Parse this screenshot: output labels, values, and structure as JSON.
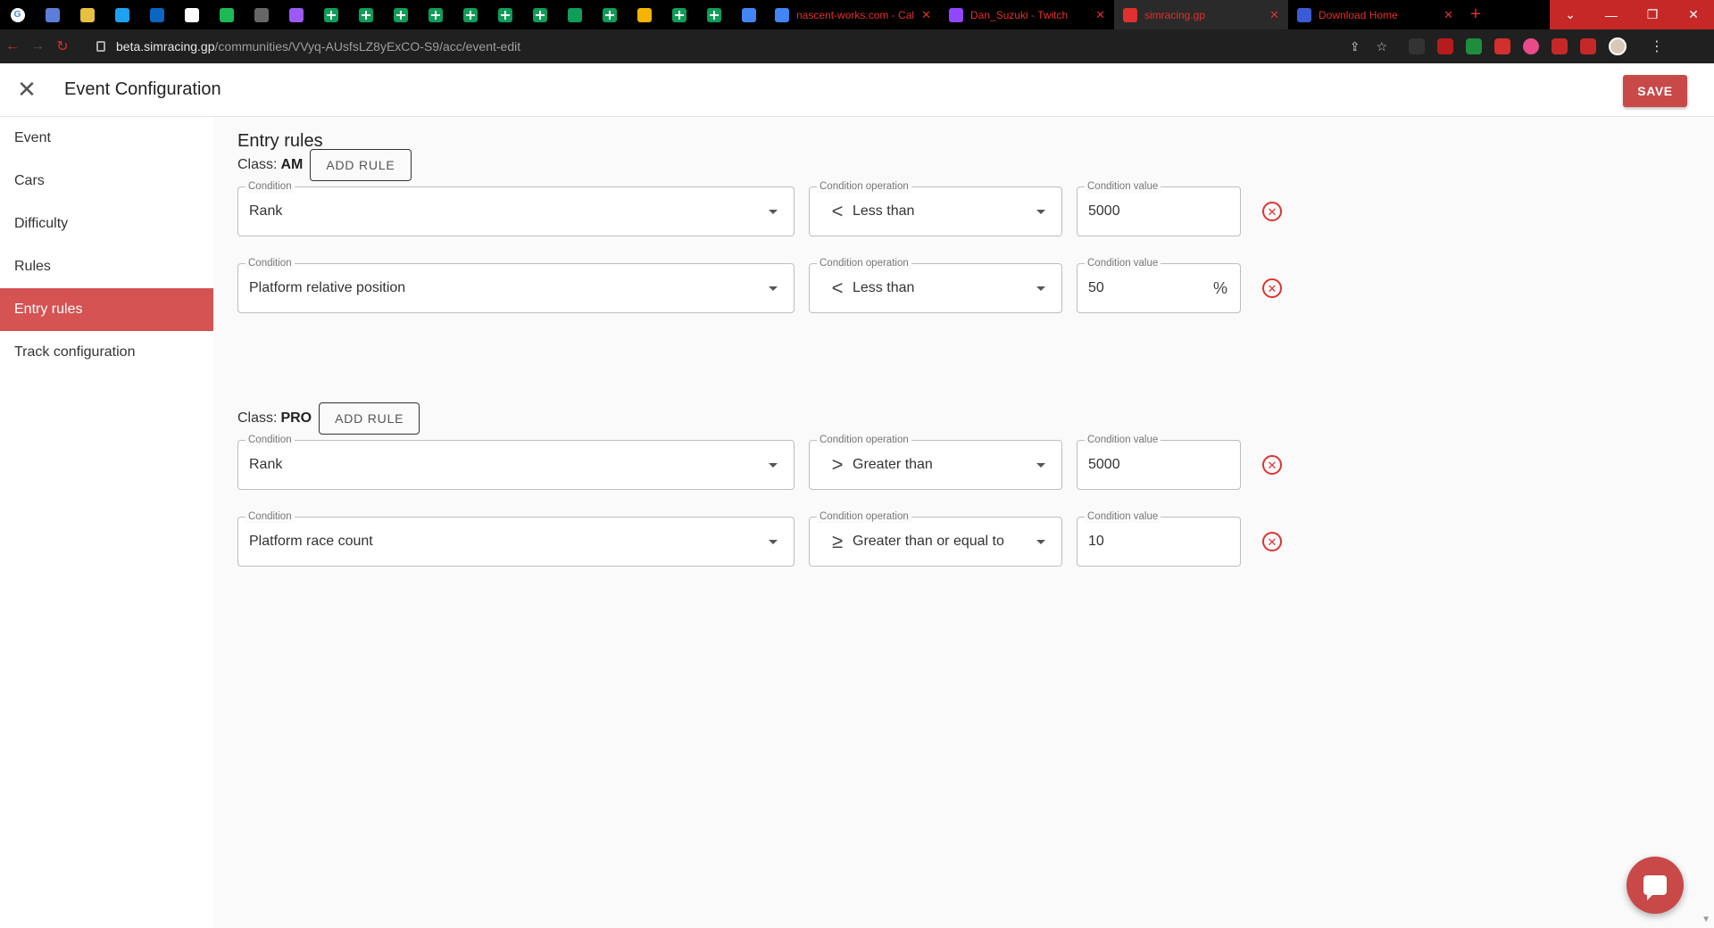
{
  "browser": {
    "pinned_tabs": [
      {
        "icon": "google-icon",
        "color": "#ffffff"
      },
      {
        "icon": "teams-icon",
        "color": "#5b7fd8"
      },
      {
        "icon": "translate-icon",
        "color": "#e8c040"
      },
      {
        "icon": "twitter-icon",
        "color": "#1da1f2"
      },
      {
        "icon": "linkedin-icon",
        "color": "#0a66c2"
      },
      {
        "icon": "patreon-icon",
        "color": "#ffffff"
      },
      {
        "icon": "spotify-icon",
        "color": "#1db954"
      },
      {
        "icon": "site-icon",
        "color": "#666666"
      },
      {
        "icon": "gem-icon",
        "color": "#9b59f5"
      },
      {
        "icon": "sheets-icon",
        "color": "#0f9d58"
      },
      {
        "icon": "sheets-icon",
        "color": "#0f9d58"
      },
      {
        "icon": "sheets-icon",
        "color": "#0f9d58"
      },
      {
        "icon": "sheets-icon",
        "color": "#0f9d58"
      },
      {
        "icon": "sheets-icon",
        "color": "#0f9d58"
      },
      {
        "icon": "sheets-icon",
        "color": "#0f9d58"
      },
      {
        "icon": "sheets-icon",
        "color": "#0f9d58"
      },
      {
        "icon": "chat-icon",
        "color": "#0f9d58"
      },
      {
        "icon": "sheets-icon",
        "color": "#0f9d58"
      },
      {
        "icon": "slides-icon",
        "color": "#f4b400"
      },
      {
        "icon": "sheets-icon",
        "color": "#0f9d58"
      },
      {
        "icon": "sheets-icon",
        "color": "#0f9d58"
      },
      {
        "icon": "docs-icon",
        "color": "#4285f4"
      }
    ],
    "tabs": [
      {
        "label": "nascent-works.com - Cal",
        "icon": "calendar-icon",
        "color": "#4285f4",
        "active": false
      },
      {
        "label": "Dan_Suzuki - Twitch",
        "icon": "twitch-icon",
        "color": "#9146ff",
        "active": false
      },
      {
        "label": "simracing.gp",
        "icon": "simracing-icon",
        "color": "#e03030",
        "active": true
      },
      {
        "label": "Download Home",
        "icon": "download-home-icon",
        "color": "#3b5bd6",
        "active": false
      }
    ],
    "url_host": "beta.simracing.gp",
    "url_path": "/communities/VVyq-AUsfsLZ8yExCO-S9/acc/event-edit"
  },
  "header": {
    "title": "Event Configuration",
    "save_label": "SAVE"
  },
  "sidebar": {
    "items": [
      {
        "label": "Event",
        "active": false
      },
      {
        "label": "Cars",
        "active": false
      },
      {
        "label": "Difficulty",
        "active": false
      },
      {
        "label": "Rules",
        "active": false
      },
      {
        "label": "Entry rules",
        "active": true
      },
      {
        "label": "Track configuration",
        "active": false
      }
    ]
  },
  "main": {
    "title": "Entry rules",
    "condition_label": "Condition",
    "operation_label": "Condition operation",
    "value_label": "Condition value",
    "add_rule_label": "ADD RULE",
    "class_prefix": "Class:",
    "classes": [
      {
        "name": "AM",
        "rules": [
          {
            "condition": "Rank",
            "op_symbol": "<",
            "operation": "Less than",
            "value": "5000",
            "unit": ""
          },
          {
            "condition": "Platform relative position",
            "op_symbol": "<",
            "operation": "Less than",
            "value": "50",
            "unit": "%"
          }
        ]
      },
      {
        "name": "PRO",
        "rules": [
          {
            "condition": "Rank",
            "op_symbol": ">",
            "operation": "Greater than",
            "value": "5000",
            "unit": ""
          },
          {
            "condition": "Platform race count",
            "op_symbol": "≥",
            "operation": "Greater than or equal to",
            "value": "10",
            "unit": ""
          }
        ]
      }
    ]
  },
  "colors": {
    "accent": "#c94848",
    "sidebar_active": "#d55353",
    "remove": "#dd3333"
  }
}
